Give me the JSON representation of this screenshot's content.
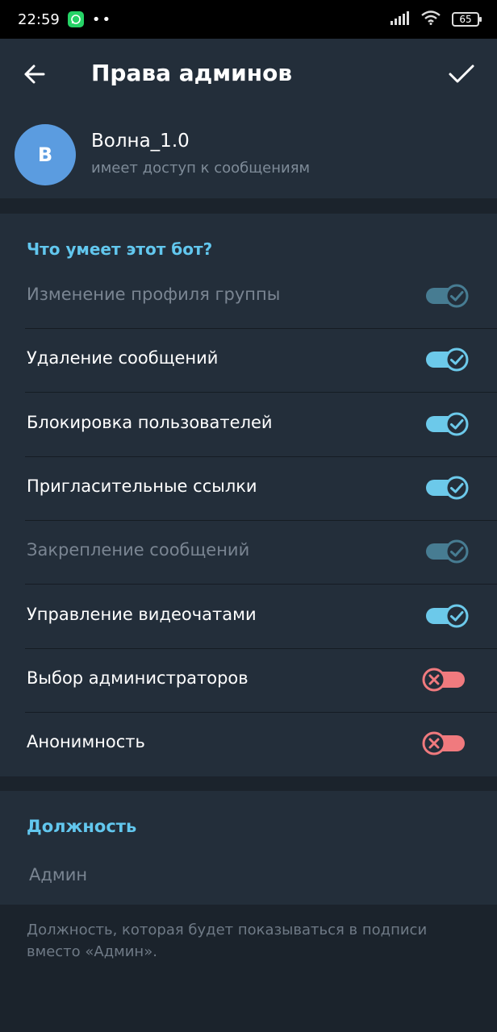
{
  "status_bar": {
    "time": "22:59",
    "battery": "65"
  },
  "app_bar": {
    "title": "Права админов"
  },
  "bot": {
    "avatar_letter": "В",
    "name": "Волна_1.0",
    "status": "имеет доступ к сообщениям"
  },
  "permissions": {
    "header": "Что умеет этот бот?",
    "items": [
      {
        "label": "Изменение профиля группы",
        "enabled": true,
        "disabled": true
      },
      {
        "label": "Удаление сообщений",
        "enabled": true,
        "disabled": false
      },
      {
        "label": "Блокировка пользователей",
        "enabled": true,
        "disabled": false
      },
      {
        "label": "Пригласительные ссылки",
        "enabled": true,
        "disabled": false
      },
      {
        "label": "Закрепление сообщений",
        "enabled": true,
        "disabled": true
      },
      {
        "label": "Управление видеочатами",
        "enabled": true,
        "disabled": false
      },
      {
        "label": "Выбор администраторов",
        "enabled": false,
        "disabled": false
      },
      {
        "label": "Анонимность",
        "enabled": false,
        "disabled": false
      }
    ]
  },
  "rank": {
    "header": "Должность",
    "placeholder": "Админ",
    "hint": "Должность, которая будет показываться в подписи вместо «Админ»."
  },
  "colors": {
    "accent": "#62c7ee",
    "switch_on": "#6cc9ea",
    "switch_off": "#f07a7e",
    "background": "#1b232c",
    "card": "#232e3a"
  }
}
